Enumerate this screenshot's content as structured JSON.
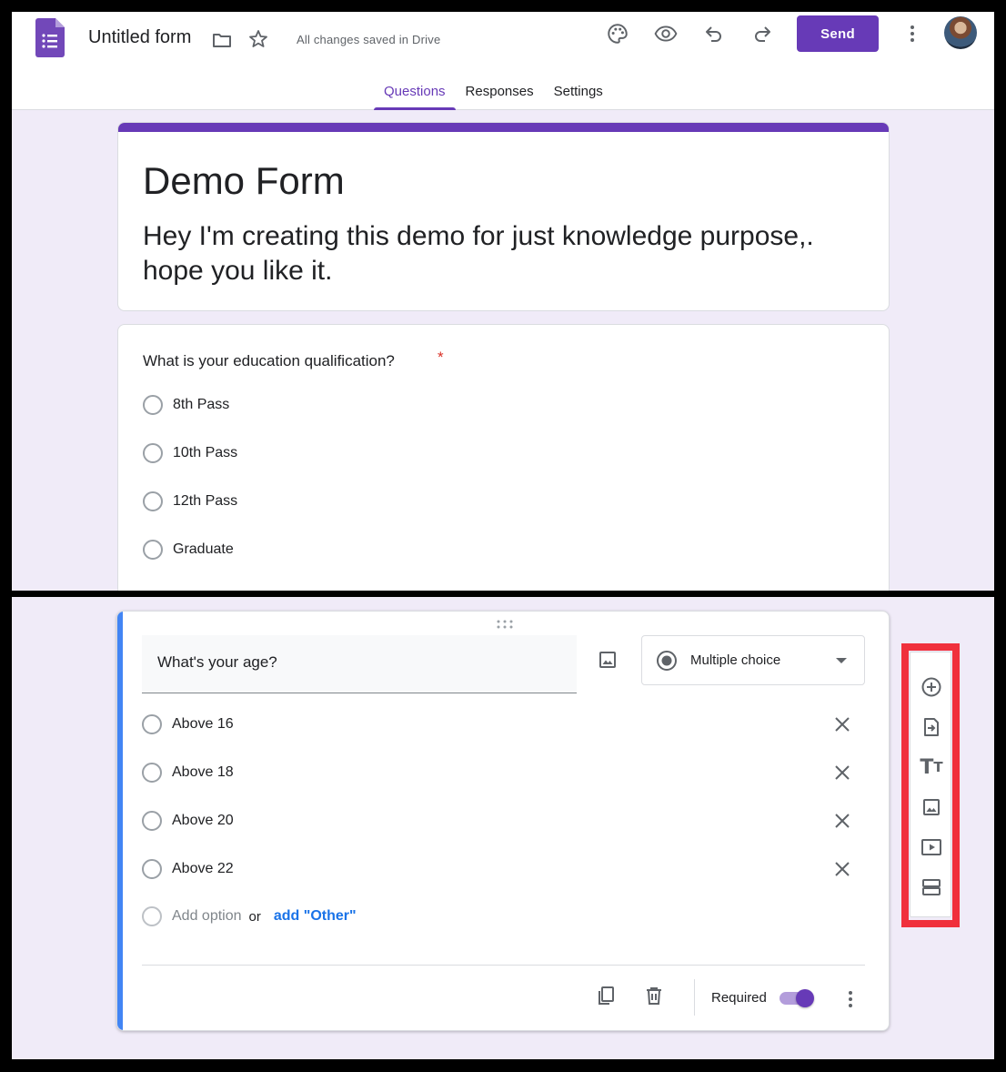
{
  "header": {
    "form_title": "Untitled form",
    "saved_status": "All changes saved in Drive",
    "send_label": "Send",
    "tabs": [
      {
        "label": "Questions",
        "active": true
      },
      {
        "label": "Responses",
        "active": false
      },
      {
        "label": "Settings",
        "active": false
      }
    ],
    "icons": [
      "forms-logo-icon",
      "folder-icon",
      "star-icon",
      "palette-icon",
      "eye-icon",
      "undo-icon",
      "redo-icon",
      "more-vert-icon"
    ]
  },
  "form": {
    "heading": "Demo Form",
    "description": "Hey I'm creating this demo for just knowledge purpose,. hope you like it."
  },
  "question1": {
    "text": "What is your education qualification?",
    "required_mark": "*",
    "options": [
      "8th Pass",
      "10th Pass",
      "12th Pass",
      "Graduate"
    ]
  },
  "question2": {
    "text": "What's your age?",
    "type": "Multiple choice",
    "options": [
      "Above 16",
      "Above 18",
      "Above 20",
      "Above 22"
    ],
    "add_option": "Add option",
    "or": "or",
    "add_other": "add \"Other\"",
    "required_label": "Required",
    "required_on": true
  },
  "toolbar": {
    "tools": [
      "add-question-icon",
      "import-questions-icon",
      "add-title-icon",
      "add-image-icon",
      "add-video-icon",
      "add-section-icon"
    ]
  },
  "colors": {
    "accent": "#673ab7",
    "background": "#f0ebf8",
    "active_bar": "#4285f4",
    "highlight": "#f0303c",
    "required": "#d93025",
    "link": "#1a73e8"
  }
}
